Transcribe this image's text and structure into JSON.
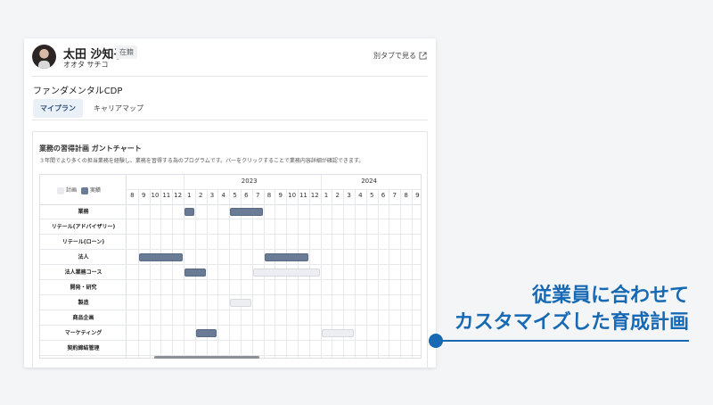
{
  "profile": {
    "name": "太田 沙知子",
    "status": "在籍",
    "kana": "オオタ サチコ",
    "open_tab_label": "別タブで見る"
  },
  "program": {
    "title": "ファンダメンタルCDP",
    "tabs": [
      {
        "label": "マイプラン",
        "active": true
      },
      {
        "label": "キャリアマップ",
        "active": false
      }
    ]
  },
  "gantt": {
    "title": "業務の習得計画 ガントチャート",
    "description": "３年間でより多くの担当業務を経験し、業務を習得する為のプログラムです。バーをクリックすることで業務内容詳細が確認できます。",
    "legend": {
      "plan": "計画",
      "actual": "実績"
    },
    "years": [
      "2023",
      "2024"
    ],
    "months": [
      "8",
      "9",
      "10",
      "11",
      "12",
      "1",
      "2",
      "3",
      "4",
      "5",
      "6",
      "7",
      "8",
      "9",
      "10",
      "11",
      "12",
      "1",
      "2",
      "3",
      "4",
      "5",
      "6",
      "7",
      "8",
      "9"
    ],
    "rows": [
      {
        "label": "業務"
      },
      {
        "label": "リテール(アドバイザリー)"
      },
      {
        "label": "リテール(ローン)"
      },
      {
        "label": "法人"
      },
      {
        "label": "法人業務コース"
      },
      {
        "label": "開発・研究"
      },
      {
        "label": "製造"
      },
      {
        "label": "商品企画"
      },
      {
        "label": "マーケティング"
      },
      {
        "label": "契約締結管理"
      }
    ],
    "bars": [
      {
        "row": 0,
        "start_month": "2023-01",
        "end_month": "2023-01",
        "kind": "actual"
      },
      {
        "row": 0,
        "start_month": "2023-05",
        "end_month": "2023-07",
        "kind": "actual"
      },
      {
        "row": 3,
        "start_month": "2022-09",
        "end_month": "2022-12",
        "kind": "actual"
      },
      {
        "row": 3,
        "start_month": "2023-08",
        "end_month": "2023-11",
        "kind": "actual"
      },
      {
        "row": 4,
        "start_month": "2023-01",
        "end_month": "2023-02",
        "kind": "actual"
      },
      {
        "row": 4,
        "start_month": "2023-07",
        "end_month": "2023-12",
        "kind": "plan"
      },
      {
        "row": 6,
        "start_month": "2023-05",
        "end_month": "2023-06",
        "kind": "plan"
      },
      {
        "row": 8,
        "start_month": "2023-02",
        "end_month": "2023-03",
        "kind": "actual"
      },
      {
        "row": 8,
        "start_month": "2024-01",
        "end_month": "2024-03",
        "kind": "plan"
      }
    ]
  },
  "callout": {
    "line1": "従業員に合わせて",
    "line2": "カスタマイズした育成計画"
  },
  "colors": {
    "accent": "#1769b3",
    "actual": "#6a7b95",
    "plan": "#eceef1"
  }
}
